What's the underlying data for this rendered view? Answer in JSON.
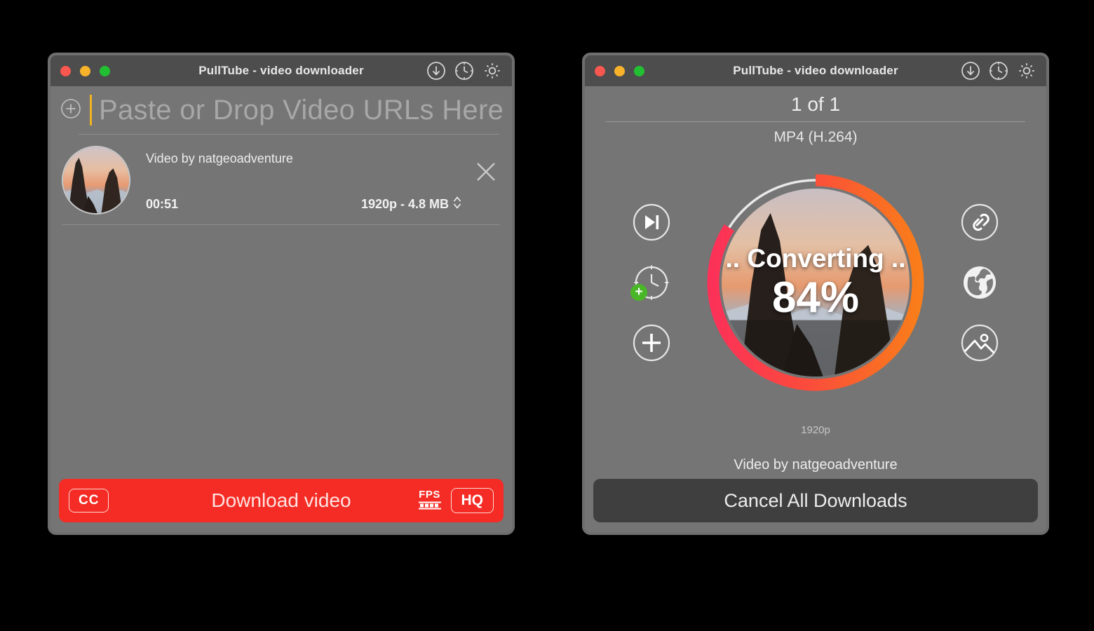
{
  "colors": {
    "window_bg": "#757575",
    "titlebar_bg": "#4d4d4d",
    "accent_red": "#f42c25",
    "ring_start": "#fc3158",
    "ring_end": "#f97d1a",
    "caret_yellow": "#f0b323",
    "badge_green": "#49b728",
    "light_red": "#f9574f",
    "light_yellow": "#f9b32b",
    "light_green": "#23bf33",
    "cancel_bar_bg": "#3f3f3f"
  },
  "left_window": {
    "titlebar": {
      "title": "PullTube - video downloader",
      "lights": [
        "close-light",
        "minimize-light",
        "zoom-light"
      ],
      "actions": [
        "download-icon",
        "clock-icon",
        "gear-icon"
      ]
    },
    "url_field": {
      "placeholder": "Paste or Drop Video URLs Here",
      "value": "",
      "add_icon": "plus-circle-icon"
    },
    "item": {
      "title": "Video by natgeoadventure",
      "duration": "00:51",
      "quality": "1920p - 4.8 MB",
      "quality_stepper_icon": "up-down-chevron-icon",
      "remove_icon": "close-icon",
      "thumbnail": "mountain-sunset-thumbnail"
    },
    "footer": {
      "cc_label": "CC",
      "download_label": "Download video",
      "fps_label": "FPS",
      "hq_label": "HQ"
    }
  },
  "right_window": {
    "titlebar": {
      "title": "PullTube - video downloader",
      "lights": [
        "close-light",
        "minimize-light",
        "zoom-light"
      ],
      "actions": [
        "download-icon",
        "clock-icon",
        "gear-icon"
      ]
    },
    "count_label": "1 of 1",
    "codec_label": "MP4 (H.264)",
    "left_icons": [
      {
        "name": "skip-next-icon",
        "badge": null
      },
      {
        "name": "clock-icon",
        "badge": "+"
      },
      {
        "name": "plus-icon",
        "badge": null
      }
    ],
    "right_icons": [
      {
        "name": "link-icon"
      },
      {
        "name": "globe-icon"
      },
      {
        "name": "image-icon"
      }
    ],
    "progress": {
      "status_label": ".. Converting ..",
      "percent_label": "84%",
      "percent_value": 84,
      "resolution_label": "1920p"
    },
    "by_label": "Video by natgeoadventure",
    "footer": {
      "cancel_label": "Cancel All Downloads"
    }
  }
}
